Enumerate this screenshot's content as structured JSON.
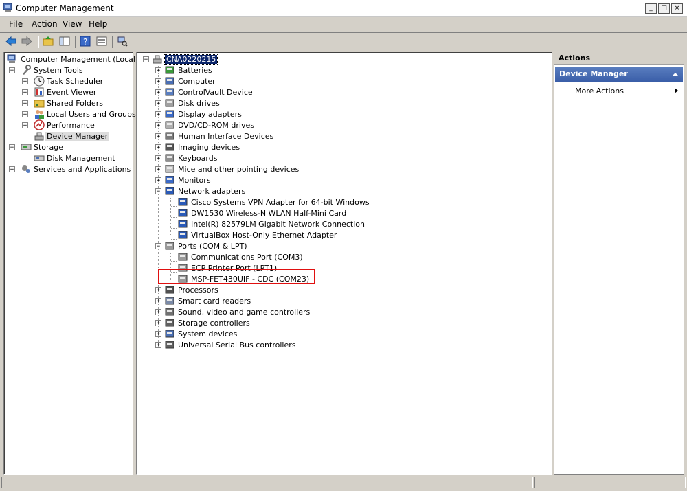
{
  "window": {
    "title": "Computer Management",
    "buttons": {
      "minimize": "_",
      "maximize": "□",
      "close": "×"
    }
  },
  "menu": [
    "File",
    "Action",
    "View",
    "Help"
  ],
  "toolbar": [
    "back-arrow-icon",
    "forward-arrow-icon",
    "up-folder-icon",
    "show-hide-tree-icon",
    "help-icon",
    "properties-icon",
    "scan-hardware-icon"
  ],
  "left_tree": [
    {
      "label": "Computer Management (Local)",
      "icon": "computer-management-icon"
    },
    {
      "label": "System Tools",
      "icon": "tools-icon",
      "expander": "−"
    },
    {
      "label": "Task Scheduler",
      "icon": "clock-icon",
      "expander": "+"
    },
    {
      "label": "Event Viewer",
      "icon": "event-viewer-icon",
      "expander": "+"
    },
    {
      "label": "Shared Folders",
      "icon": "shared-folder-icon",
      "expander": "+"
    },
    {
      "label": "Local Users and Groups",
      "icon": "users-icon",
      "expander": "+"
    },
    {
      "label": "Performance",
      "icon": "performance-icon",
      "expander": "+"
    },
    {
      "label": "Device Manager",
      "icon": "device-manager-icon",
      "selected": true
    },
    {
      "label": "Storage",
      "icon": "storage-icon",
      "expander": "−"
    },
    {
      "label": "Disk Management",
      "icon": "disk-management-icon"
    },
    {
      "label": "Services and Applications",
      "icon": "services-icon",
      "expander": "+"
    }
  ],
  "device_tree": {
    "root": "CNA0220215",
    "items": [
      {
        "label": "Batteries",
        "icon": "battery-icon",
        "expander": "+"
      },
      {
        "label": "Computer",
        "icon": "computer-icon",
        "expander": "+"
      },
      {
        "label": "ControlVault Device",
        "icon": "controlvault-icon",
        "expander": "+"
      },
      {
        "label": "Disk drives",
        "icon": "disk-drive-icon",
        "expander": "+"
      },
      {
        "label": "Display adapters",
        "icon": "display-adapter-icon",
        "expander": "+"
      },
      {
        "label": "DVD/CD-ROM drives",
        "icon": "dvd-drive-icon",
        "expander": "+"
      },
      {
        "label": "Human Interface Devices",
        "icon": "hid-icon",
        "expander": "+"
      },
      {
        "label": "Imaging devices",
        "icon": "camera-icon",
        "expander": "+"
      },
      {
        "label": "Keyboards",
        "icon": "keyboard-icon",
        "expander": "+"
      },
      {
        "label": "Mice and other pointing devices",
        "icon": "mouse-icon",
        "expander": "+"
      },
      {
        "label": "Monitors",
        "icon": "monitor-icon",
        "expander": "+"
      },
      {
        "label": "Network adapters",
        "icon": "network-adapter-icon",
        "expander": "−"
      },
      {
        "label": "Cisco Systems VPN Adapter for 64-bit Windows",
        "icon": "network-adapter-disabled-icon",
        "child": true
      },
      {
        "label": "DW1530 Wireless-N WLAN Half-Mini Card",
        "icon": "network-adapter-icon",
        "child": true
      },
      {
        "label": "Intel(R) 82579LM Gigabit Network Connection",
        "icon": "network-adapter-icon",
        "child": true
      },
      {
        "label": "VirtualBox Host-Only Ethernet Adapter",
        "icon": "network-adapter-icon",
        "child": true
      },
      {
        "label": "Ports (COM & LPT)",
        "icon": "port-icon",
        "expander": "−"
      },
      {
        "label": "Communications Port (COM3)",
        "icon": "port-icon",
        "child": true
      },
      {
        "label": "ECP Printer Port (LPT1)",
        "icon": "port-icon",
        "child": true
      },
      {
        "label": "MSP-FET430UIF - CDC (COM23)",
        "icon": "port-icon",
        "child": true
      },
      {
        "label": "Processors",
        "icon": "processor-icon",
        "expander": "+"
      },
      {
        "label": "Smart card readers",
        "icon": "smart-card-reader-icon",
        "expander": "+"
      },
      {
        "label": "Sound, video and game controllers",
        "icon": "sound-icon",
        "expander": "+"
      },
      {
        "label": "Storage controllers",
        "icon": "storage-controller-icon",
        "expander": "+"
      },
      {
        "label": "System devices",
        "icon": "system-devices-icon",
        "expander": "+"
      },
      {
        "label": "Universal Serial Bus controllers",
        "icon": "usb-icon",
        "expander": "+"
      }
    ]
  },
  "actions": {
    "header": "Actions",
    "section": "Device Manager",
    "more": "More Actions"
  },
  "colors": {
    "highlight_box": "#e01010",
    "actions_section": "#3a5ea8",
    "root_selection": "#0a246a"
  }
}
